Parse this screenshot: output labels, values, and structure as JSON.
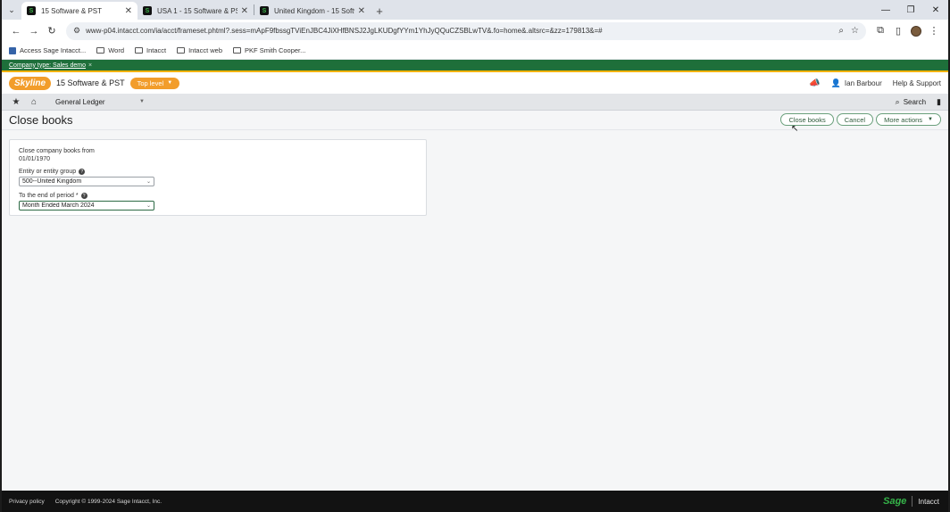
{
  "browser": {
    "tabs": [
      {
        "title": "15 Software & PST",
        "active": true
      },
      {
        "title": "USA 1 - 15 Software & PST",
        "active": false
      },
      {
        "title": "United Kingdom - 15 Software",
        "active": false
      }
    ],
    "url": "www-p04.intacct.com/ia/acct/frameset.phtml?.sess=mApF9fbssgTViEnJBC4JiXHfBNSJ2JgLKUDgfYYm1YhJyQQuCZSBLwTV&.fo=home&.altsrc=&zz=179813&=#",
    "bookmarks": [
      {
        "label": "Access Sage Intacct...",
        "type": "link"
      },
      {
        "label": "Word",
        "type": "folder"
      },
      {
        "label": "Intacct",
        "type": "folder"
      },
      {
        "label": "Intacct web",
        "type": "folder"
      },
      {
        "label": "PKF Smith Cooper...",
        "type": "folder"
      }
    ]
  },
  "company_banner": {
    "text": "Company type: Sales demo",
    "close": "×"
  },
  "header": {
    "logo": "Skyline",
    "company": "15 Software & PST",
    "level": "Top level",
    "user": "Ian Barbour",
    "help": "Help & Support"
  },
  "module_nav": {
    "module": "General Ledger",
    "search": "Search"
  },
  "page": {
    "title": "Close books",
    "actions": {
      "close_books": "Close books",
      "cancel": "Cancel",
      "more_actions": "More actions"
    }
  },
  "form": {
    "close_from_label": "Close company books from",
    "close_from_value": "01/01/1970",
    "entity_label": "Entity or entity group",
    "entity_value": "500--United Kingdom",
    "period_label": "To the end of period",
    "period_required": "*",
    "period_value": "Month Ended March 2024"
  },
  "footer": {
    "privacy": "Privacy policy",
    "copyright": "Copyright © 1999-2024 Sage Intacct, Inc.",
    "brand_sage": "Sage",
    "brand_intacct": "Intacct"
  },
  "colors": {
    "brand_green": "#1e6f3a",
    "accent_orange": "#f29d2b",
    "sage_green": "#35b449"
  }
}
